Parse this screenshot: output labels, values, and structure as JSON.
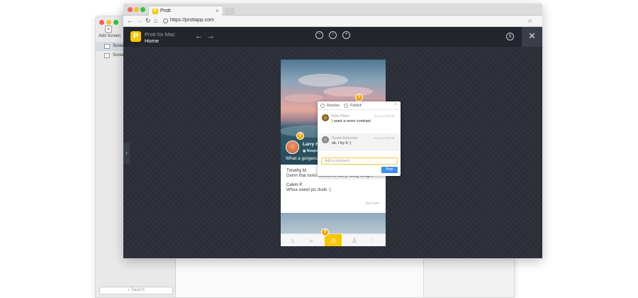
{
  "background_app": {
    "add_screen_label": "Add Screen",
    "screens": [
      "Scree",
      "Scree"
    ],
    "search_placeholder": "Search"
  },
  "browser": {
    "tab_title": "Prott",
    "url": "https://prottapp.com"
  },
  "app": {
    "name": "Prott for Mac",
    "page": "Home",
    "coin_label": "$"
  },
  "post": {
    "user": "Larry Ha",
    "location": "Newpo",
    "caption": "What a gorgeous",
    "comments": [
      {
        "name": "Timothy M.",
        "text": "Damn that looks awesome Larry! BBQ tonight?"
      },
      {
        "name": "Calvin P.",
        "text": "Whoa sweet pic dude :)"
      }
    ],
    "timestamp": "Just now"
  },
  "pins": [
    "1",
    "2",
    "3"
  ],
  "popup": {
    "resolve_label": "Resolve",
    "publish_label": "Publish",
    "comments": [
      {
        "name": "Kate Olsen",
        "time": "02/14 10:00 PM",
        "text": "I want a more contrast."
      },
      {
        "name": "Susan Anderson",
        "time": "02/14 10:00 PM",
        "text": "ok. I try it :)"
      }
    ],
    "input_placeholder": "Add a comment",
    "post_label": "Post"
  },
  "colors": {
    "brand_yellow": "#f7c600",
    "pin_orange": "#f7a500",
    "app_bg": "#2b2e36",
    "post_button": "#3d8ee6"
  }
}
